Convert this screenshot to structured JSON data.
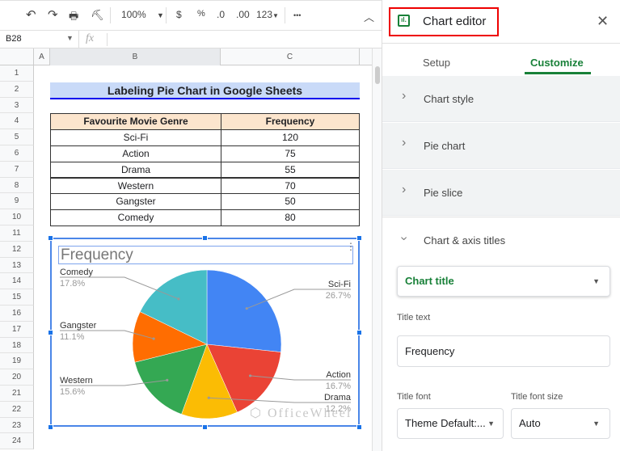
{
  "toolbar": {
    "zoom": "100%",
    "currency": "$",
    "percent": "%",
    "dec_decrease": ".0",
    "dec_increase": ".00",
    "format": "123",
    "more": "•••"
  },
  "formula_bar": {
    "cell_ref": "B28",
    "fx": "fx",
    "value": ""
  },
  "columns": [
    "A",
    "B",
    "C"
  ],
  "rows": [
    "1",
    "2",
    "3",
    "4",
    "5",
    "6",
    "7",
    "8",
    "9",
    "10",
    "11",
    "12",
    "13",
    "14",
    "15",
    "16",
    "17",
    "18",
    "19",
    "20",
    "21",
    "22",
    "23",
    "24"
  ],
  "sheet": {
    "title": "Labeling Pie Chart in Google Sheets",
    "headers": [
      "Favourite Movie Genre",
      "Frequency"
    ],
    "data": [
      [
        "Sci-Fi",
        "120"
      ],
      [
        "Action",
        "75"
      ],
      [
        "Drama",
        "55"
      ],
      [
        "Western",
        "70"
      ],
      [
        "Gangster",
        "50"
      ],
      [
        "Comedy",
        "80"
      ]
    ]
  },
  "chart_data": {
    "type": "pie",
    "title": "Frequency",
    "slices": [
      {
        "label": "Sci-Fi",
        "value": 120,
        "pct": "26.7%",
        "color": "#4285f4"
      },
      {
        "label": "Action",
        "value": 75,
        "pct": "16.7%",
        "color": "#ea4335"
      },
      {
        "label": "Drama",
        "value": 55,
        "pct": "12.2%",
        "color": "#fbbc04"
      },
      {
        "label": "Western",
        "value": 70,
        "pct": "15.6%",
        "color": "#34a853"
      },
      {
        "label": "Gangster",
        "value": 50,
        "pct": "11.1%",
        "color": "#ff6d01"
      },
      {
        "label": "Comedy",
        "value": 80,
        "pct": "17.8%",
        "color": "#46bdc6"
      }
    ],
    "legend": "labeled"
  },
  "watermark": "OfficeWheel",
  "panel": {
    "title": "Chart editor",
    "tabs": [
      "Setup",
      "Customize"
    ],
    "active_tab": "Customize",
    "sections": [
      "Chart style",
      "Pie chart",
      "Pie slice",
      "Chart & axis titles"
    ],
    "title_select": "Chart title",
    "title_text_label": "Title text",
    "title_text_value": "Frequency",
    "font_label": "Title font",
    "font_value": "Theme Default:...",
    "size_label": "Title font size",
    "size_value": "Auto",
    "accent": "#188038"
  }
}
